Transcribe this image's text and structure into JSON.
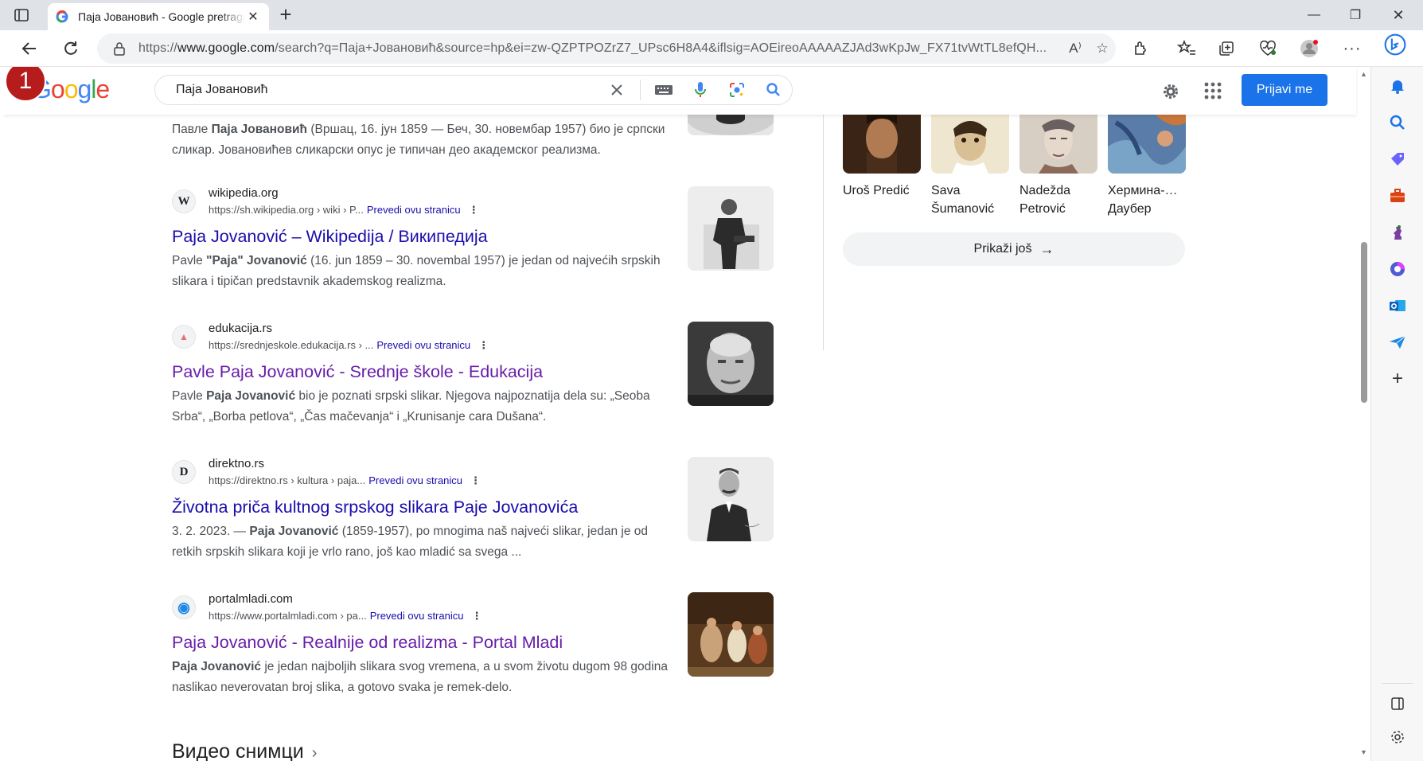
{
  "browser": {
    "tab_title": "Паја Јовановић - Google pretraga",
    "url_prefix": "https://",
    "url_host": "www.google.com",
    "url_rest": "/search?q=Паја+Јовановић&source=hp&ei=zw-QZPTPOZrZ7_UPsc6H8A4&iflsig=AOEireoAAAAAZJAd3wKpJw_FX71tvWtTL8efQH...",
    "read_aloud_label": "A⁾"
  },
  "google": {
    "logo_letters": [
      {
        "ch": "G",
        "color": "#4285f4"
      },
      {
        "ch": "o",
        "color": "#ea4335"
      },
      {
        "ch": "o",
        "color": "#fbbc05"
      },
      {
        "ch": "g",
        "color": "#4285f4"
      },
      {
        "ch": "l",
        "color": "#34a853"
      },
      {
        "ch": "e",
        "color": "#ea4335"
      }
    ],
    "query": "Паја Јовановић",
    "signin_label": "Prijavi me",
    "badge_number": "1"
  },
  "top_snippet": {
    "pre": "Павле ",
    "bold": "Паја Јовановић",
    "post": " (Вршац, 16. јун 1859 — Беч, 30. новембар 1957) био је српски сликар. Јовановићев сликарски опус је типичан део академског реализма."
  },
  "results": [
    {
      "site": "wikipedia.org",
      "favicon": "W",
      "cite": "https://sh.wikipedia.org › wiki › P...",
      "translate": "Prevedi ovu stranicu",
      "title": "Paja Jovanović – Wikipedija / Википедија",
      "visited": false,
      "snippet_pre": "Pavle ",
      "snippet_bold": "\"Paja\" Jovanović",
      "snippet_post": " (16. jun 1859 – 30. novembal 1957) je jedan od najvećih srpskih slikara i tipičan predstavnik akademskog realizma."
    },
    {
      "site": "edukacija.rs",
      "favicon": "▲",
      "cite": "https://srednjeskole.edukacija.rs › ...",
      "translate": "Prevedi ovu stranicu",
      "title": "Pavle Paja Jovanović - Srednje škole - Edukacija",
      "visited": true,
      "snippet_pre": "Pavle ",
      "snippet_bold": "Paja Jovanović",
      "snippet_post": " bio je poznati srpski slikar. Njegova najpoznatija dela su: „Seoba Srba“, „Borba petlova“, „Čas mačevanja“ i „Krunisanje cara Dušana“."
    },
    {
      "site": "direktno.rs",
      "favicon": "D",
      "cite": "https://direktno.rs › kultura › paja...",
      "translate": "Prevedi ovu stranicu",
      "title": "Životna priča kultnog srpskog slikara Paje Jovanovića",
      "visited": false,
      "snippet_pre": "3. 2. 2023. — ",
      "snippet_bold": "Paja Jovanović",
      "snippet_post": " (1859-1957), po mnogima naš najveći slikar, jedan je od retkih srpskih slikara koji je vrlo rano, još kao mladić sa svega ..."
    },
    {
      "site": "portalmladi.com",
      "favicon": "◉",
      "cite": "https://www.portalmladi.com › pa...",
      "translate": "Prevedi ovu stranicu",
      "title": "Paja Jovanović - Realnije od realizma - Portal Mladi",
      "visited": true,
      "snippet_pre": "",
      "snippet_bold": "Paja Jovanović",
      "snippet_post": " je jedan najboljih slikara svog vremena, a u svom životu dugom 98 godina naslikao neverovatan broj slika, a gotovo svaka je remek-delo."
    }
  ],
  "videos_heading": "Видео снимци",
  "knowledge_panel": {
    "people": [
      {
        "name_line1": "Uroš Predić",
        "name_line2": ""
      },
      {
        "name_line1": "Sava",
        "name_line2": "Šumanović"
      },
      {
        "name_line1": "Nadežda",
        "name_line2": "Petrović"
      },
      {
        "name_line1": "Хермина-…",
        "name_line2": "Даубер"
      }
    ],
    "show_more": "Prikaži još"
  }
}
